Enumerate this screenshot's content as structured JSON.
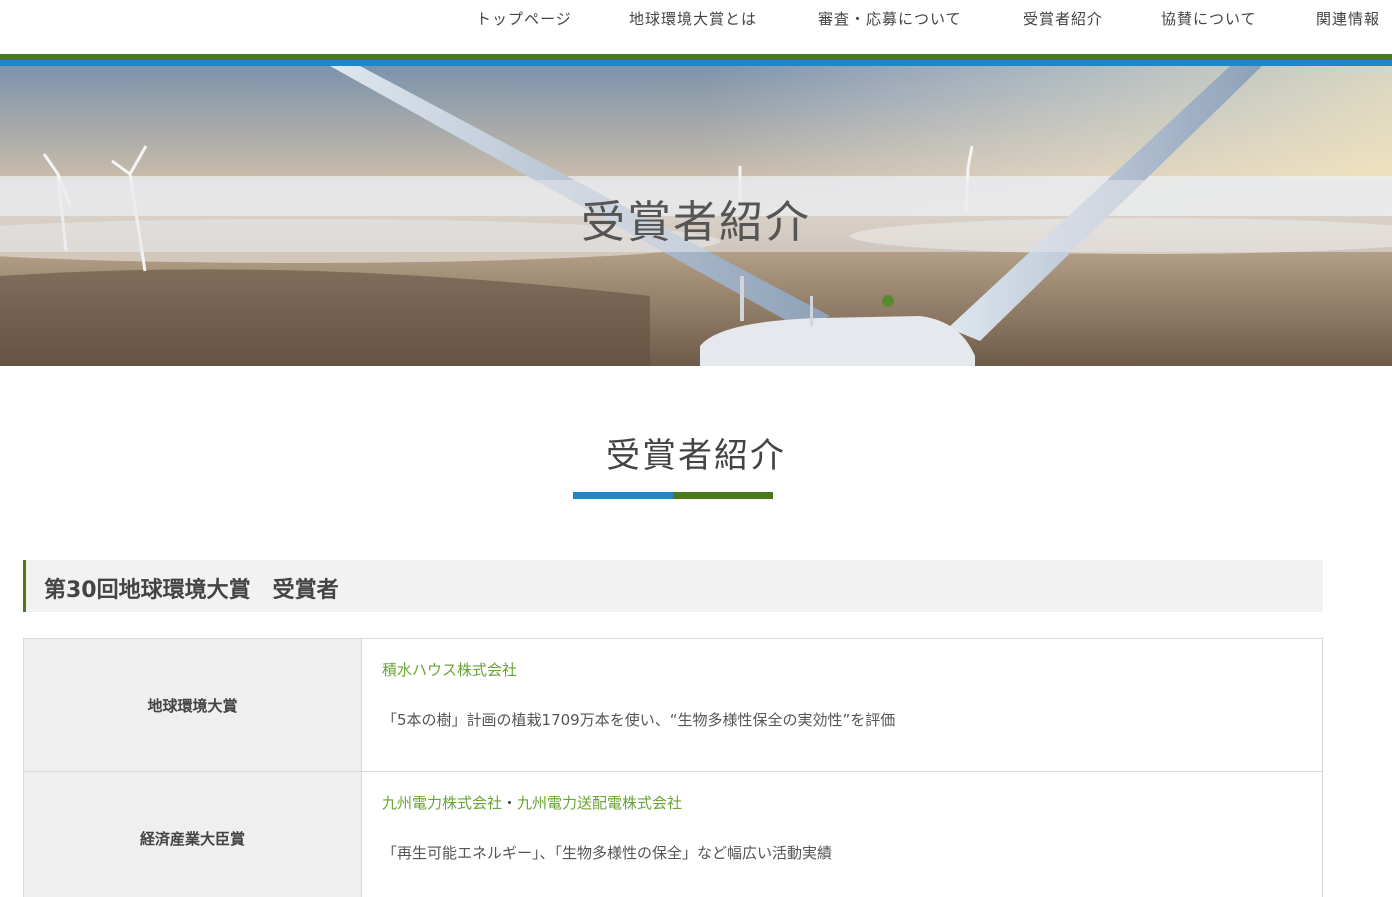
{
  "nav": {
    "items": [
      {
        "label": "トップページ"
      },
      {
        "label": "地球環境大賞とは"
      },
      {
        "label": "審査・応募について"
      },
      {
        "label": "受賞者紹介"
      },
      {
        "label": "協賛について"
      },
      {
        "label": "関連情報"
      }
    ]
  },
  "colors": {
    "green": "#4a7a1c",
    "blue": "#1e87c8",
    "link_green": "#6aa336"
  },
  "hero": {
    "title": "受賞者紹介"
  },
  "section": {
    "title": "受賞者紹介",
    "subheading": "第30回地球環境大賞　受賞者"
  },
  "awards": [
    {
      "award": "地球環境大賞",
      "winners": [
        "積水ハウス株式会社"
      ],
      "description": "「5本の樹」計画の植栽1709万本を使い、“生物多様性保全の実効性”を評価"
    },
    {
      "award": "経済産業大臣賞",
      "winners": [
        "九州電力株式会社",
        "九州電力送配電株式会社"
      ],
      "separator": "・",
      "description": "「再生可能エネルギー」、「生物多様性の保全」など幅広い活動実績"
    }
  ]
}
